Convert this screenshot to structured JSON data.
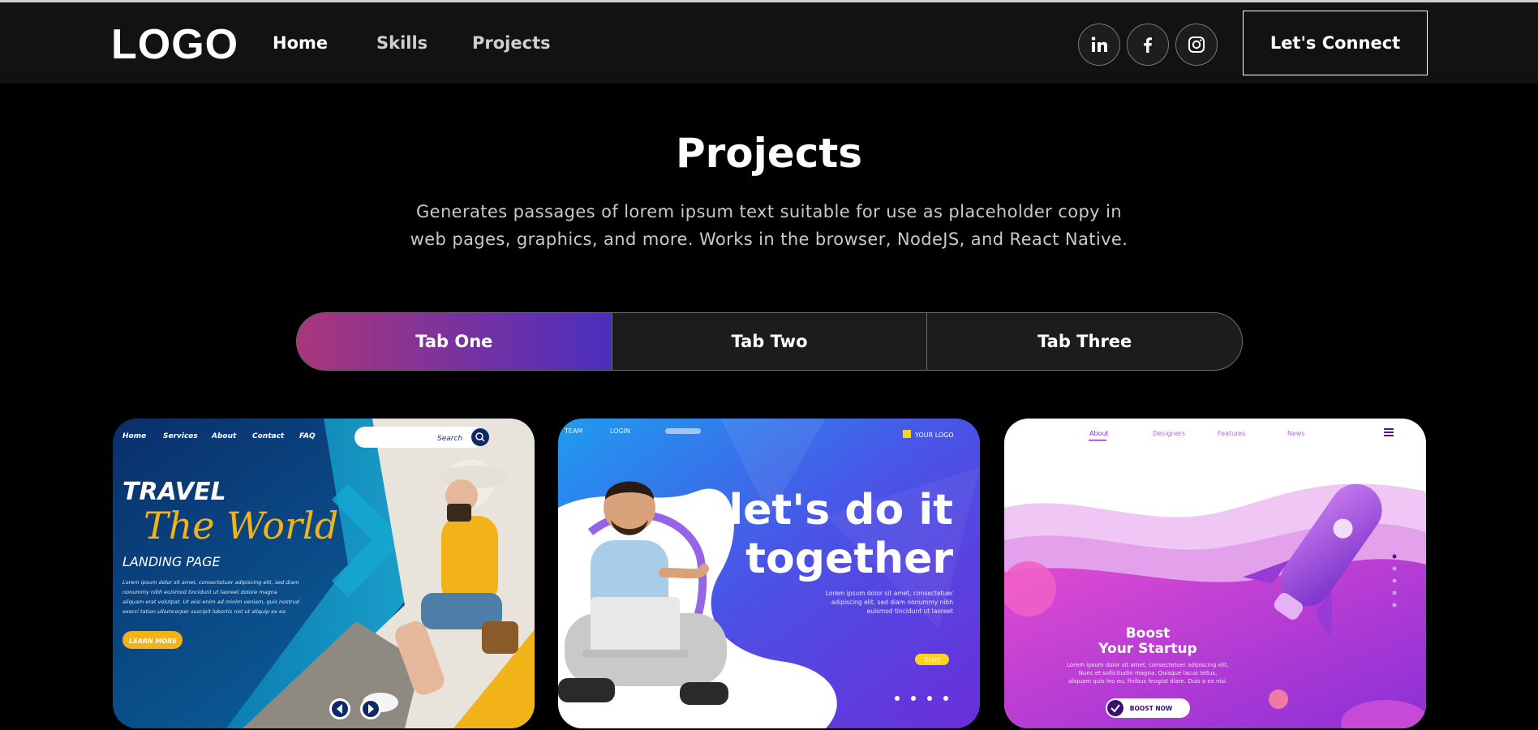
{
  "navbar": {
    "logo": "LOGO",
    "links": [
      "Home",
      "Skills",
      "Projects"
    ],
    "social_icons": [
      "linkedin-icon",
      "facebook-icon",
      "instagram-icon"
    ],
    "connect_label": "Let's Connect"
  },
  "projects": {
    "title": "Projects",
    "description": "Generates passages of lorem ipsum text suitable for use as placeholder copy in web pages, graphics, and more. Works in the browser, NodeJS, and React Native.",
    "tabs": [
      "Tab One",
      "Tab Two",
      "Tab Three"
    ],
    "active_tab": 0
  },
  "cards": [
    {
      "nav": [
        "Home",
        "Services",
        "About",
        "Contact",
        "FAQ"
      ],
      "search_placeholder": "Search",
      "headline": "TRAVEL",
      "script": "The World",
      "subtitle": "LANDING PAGE",
      "body": [
        "Lorem ipsum dolor sit amet, consectetuer adipiscing elit, sed diam",
        "nonummy nibh euismod tincidunt ut laoreet dolore magna",
        "aliquam erat volutpat. Ut wisi enim ad minim veniam, quis nostrud",
        "exerci tation ullamcorper suscipit lobortis nisl ut aliquip ex ea"
      ],
      "button": "LEARN MORE"
    },
    {
      "nav": [
        "TEAM",
        "LOGIN"
      ],
      "brand": "YOUR LOGO",
      "headline_1": "let's do it",
      "headline_2": "together",
      "body": [
        "Lorem ipsum dolor sit amet, consectetuer",
        "adipiscing elit, sed diam nonummy nibh",
        "euismod tincidunt ut laoreet"
      ],
      "button": "Start"
    },
    {
      "nav": [
        "About",
        "Designers",
        "Features",
        "News"
      ],
      "headline_1": "Boost",
      "headline_2": "Your Startup",
      "body": [
        "Lorem ipsum dolor sit amet, consectetuer adipiscing elit,",
        "Nunc et sollicitudin magna. Quisque lacus tellus,",
        "aliquam quis leo eu, finibus feugiat diam. Duis a ex nisi."
      ],
      "button": "BOOST NOW"
    }
  ],
  "colors": {
    "tab_gradient_start": "#aa367c",
    "tab_gradient_end": "#4a2fbd",
    "navbar_bg": "#121212",
    "page_bg": "#000000"
  }
}
